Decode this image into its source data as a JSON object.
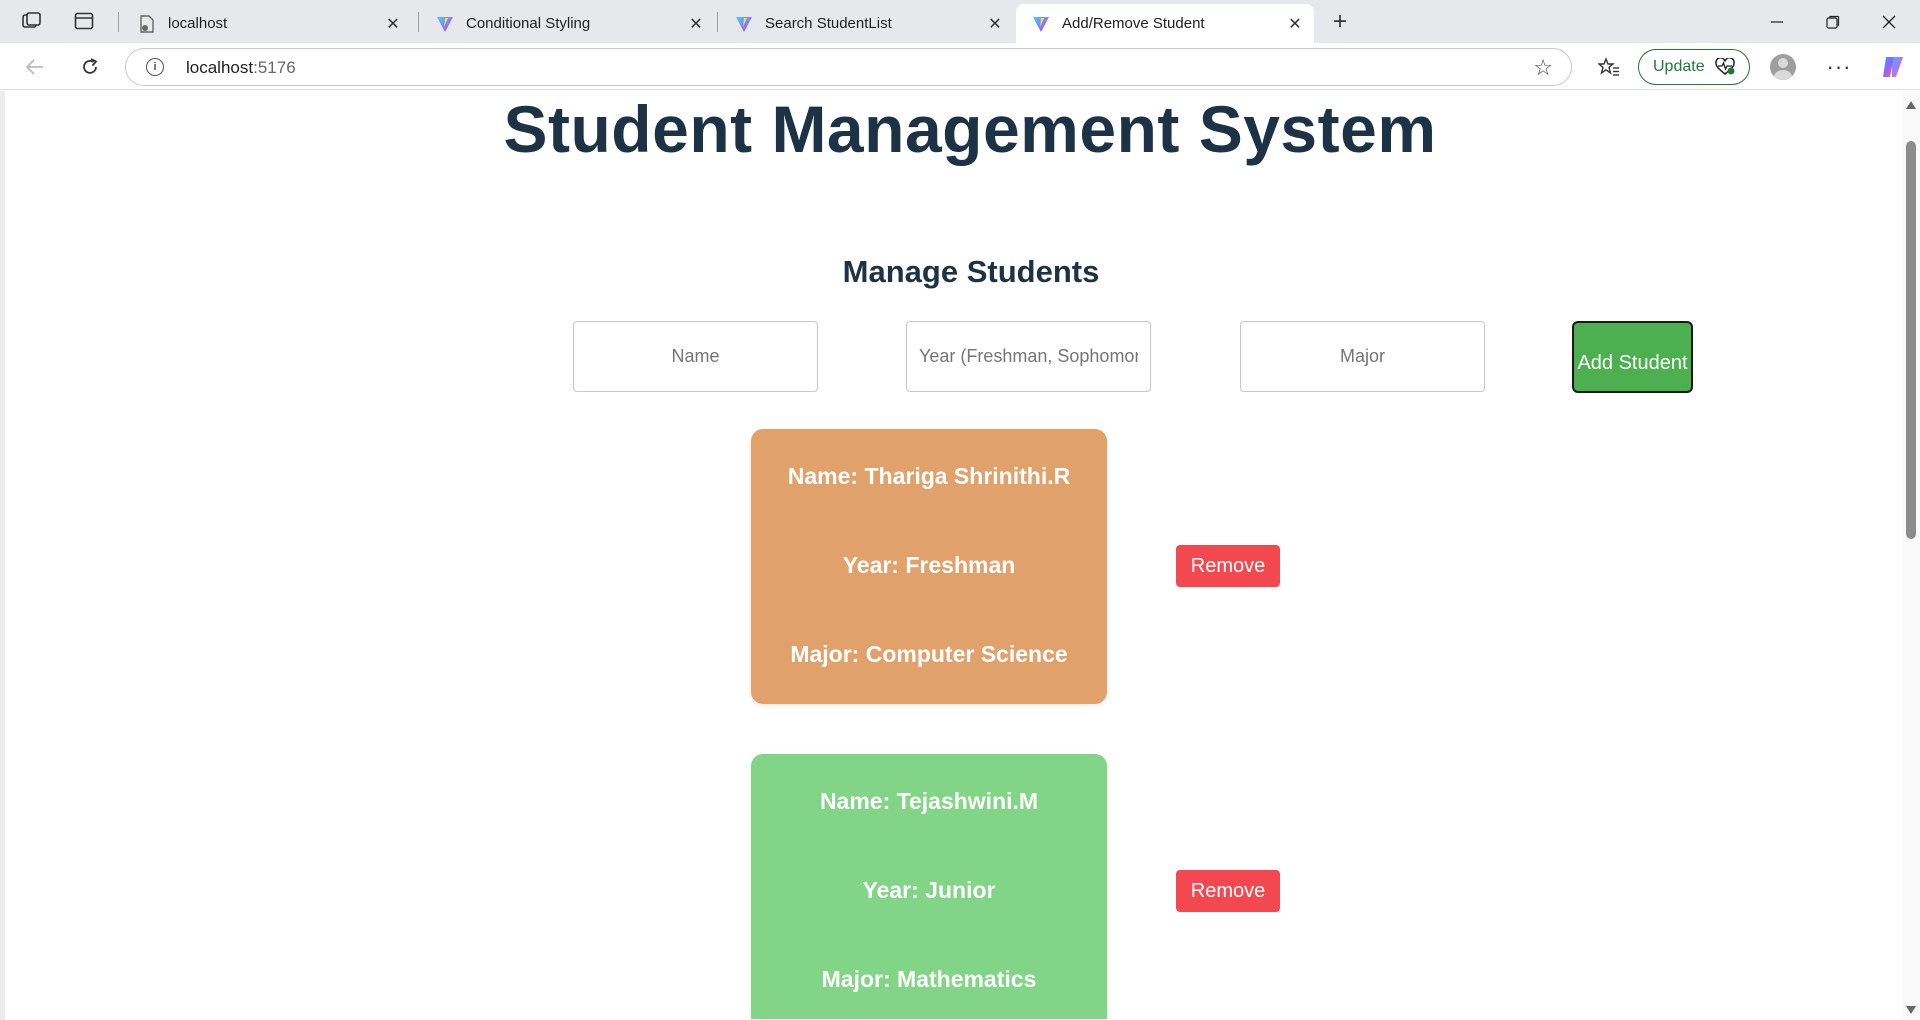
{
  "browser": {
    "tabs": [
      {
        "title": "localhost"
      },
      {
        "title": "Conditional Styling"
      },
      {
        "title": "Search StudentList"
      },
      {
        "title": "Add/Remove Student"
      }
    ],
    "url_host": "localhost",
    "url_port": ":5176",
    "update_label": "Update",
    "icons": {
      "workspaces": "workspaces-icon",
      "tab_actions": "tab-actions-icon",
      "back": "back-arrow-icon",
      "reload": "reload-icon",
      "info": "site-info-icon",
      "favorite": "star-icon",
      "favorites_list": "favorites-icon",
      "more": "more-icon",
      "copilot": "copilot-icon"
    },
    "accent_update": "#1f7a3a"
  },
  "page": {
    "title": "Student Management System",
    "section_title": "Manage Students",
    "form": {
      "name_placeholder": "Name",
      "year_placeholder": "Year (Freshman, Sophomore",
      "major_placeholder": "Major",
      "add_label": "Add Student",
      "add_color": "#4caf50"
    },
    "students": [
      {
        "name_line": "Name: Thariga Shrinithi.R",
        "year_line": "Year: Freshman",
        "major_line": "Major: Computer Science",
        "card_color": "#e1a16a",
        "remove_label": "Remove"
      },
      {
        "name_line": "Name: Tejashwini.M",
        "year_line": "Year: Junior",
        "major_line": "Major: Mathematics",
        "card_color": "#82d586",
        "remove_label": "Remove"
      }
    ],
    "remove_color": "#f44850"
  }
}
